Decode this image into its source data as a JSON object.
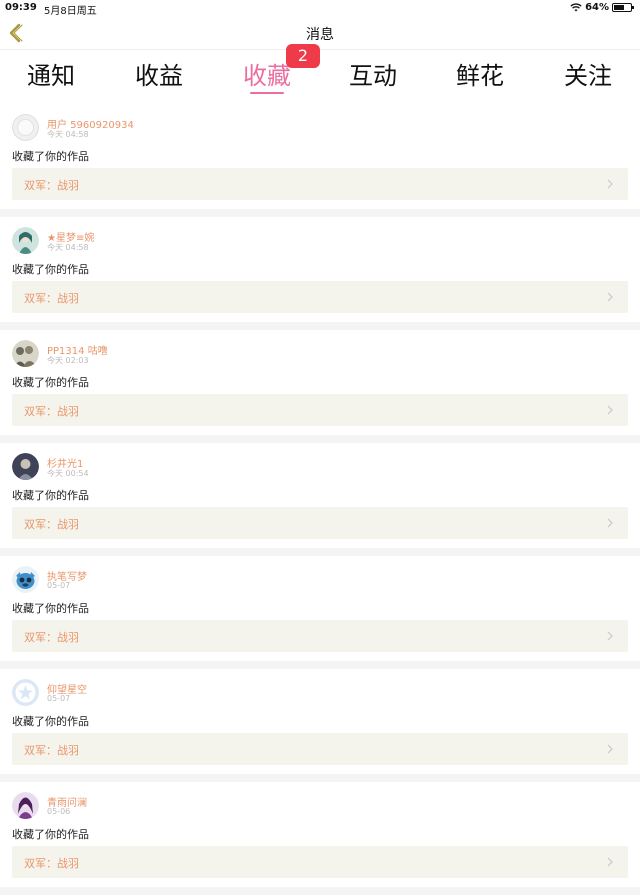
{
  "statusbar": {
    "time": "09:39",
    "date": "5月8日周五",
    "battery_text": "64%",
    "battery_level": 0.64
  },
  "nav": {
    "title": "消息"
  },
  "tabs": [
    {
      "label": "通知"
    },
    {
      "label": "收益"
    },
    {
      "label": "收藏",
      "active": true,
      "badge": "2"
    },
    {
      "label": "互动"
    },
    {
      "label": "鲜花"
    },
    {
      "label": "关注"
    }
  ],
  "colors": {
    "accent": "#ea6fa0",
    "badge": "#ef3a4a",
    "username": "#e9966a",
    "card": "#f5f4ec"
  },
  "items": [
    {
      "user": "用户 5960920934",
      "time": "今天 04:58",
      "action": "收藏了你的作品",
      "work_prefix": "双军：",
      "work_title": "战羽",
      "avatar": "blank-avatar"
    },
    {
      "user": "★星梦≡婉",
      "time": "今天 04:58",
      "action": "收藏了你的作品",
      "work_prefix": "双军：",
      "work_title": "战羽",
      "avatar": "girl-avatar"
    },
    {
      "user": "PP1314 咕噜",
      "time": "今天 02:03",
      "action": "收藏了你的作品",
      "work_prefix": "双军：",
      "work_title": "战羽",
      "avatar": "group-avatar"
    },
    {
      "user": "杉井光1",
      "time": "今天 00:54",
      "action": "收藏了你的作品",
      "work_prefix": "双军：",
      "work_title": "战羽",
      "avatar": "dark-avatar"
    },
    {
      "user": "执笔写梦",
      "time": "05-07",
      "action": "收藏了你的作品",
      "work_prefix": "双军：",
      "work_title": "战羽",
      "avatar": "stitch-avatar"
    },
    {
      "user": "仰望星空",
      "time": "05-07",
      "action": "收藏了你的作品",
      "work_prefix": "双军：",
      "work_title": "战羽",
      "avatar": "star-avatar"
    },
    {
      "user": "青雨问澜",
      "time": "05-06",
      "action": "收藏了你的作品",
      "work_prefix": "双军：",
      "work_title": "战羽",
      "avatar": "purple-avatar"
    }
  ]
}
